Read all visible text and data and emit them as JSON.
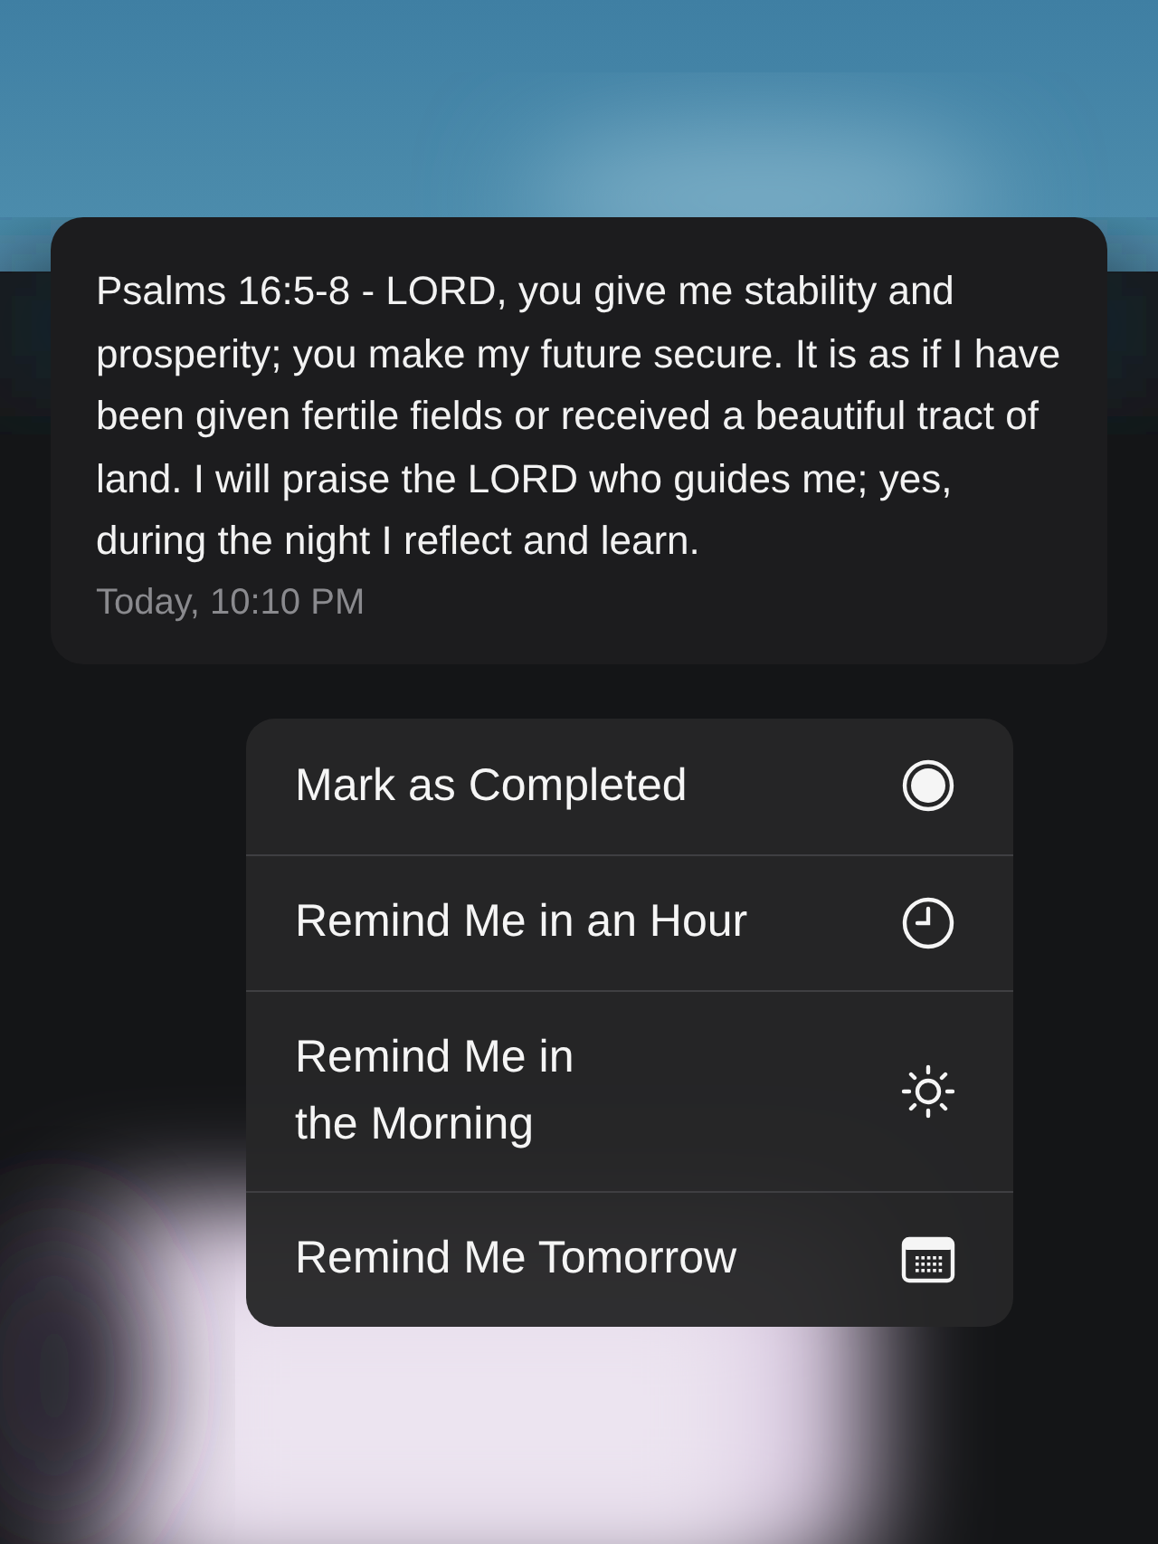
{
  "notification": {
    "message": "Psalms 16:5-8 - LORD, you give me stability and prosperity; you make my future secure. It is as if I have been given fertile fields or received a beautiful tract of land. I will praise the LORD who guides me; yes, during the night I reflect and learn.",
    "time": "Today, 10:10 PM"
  },
  "menu": [
    {
      "label": "Mark as Completed",
      "kind": "circle"
    },
    {
      "label": "Remind Me in an Hour",
      "kind": "clock"
    },
    {
      "label": "Remind Me in\nthe Morning",
      "kind": "sun"
    },
    {
      "label": "Remind Me Tomorrow",
      "kind": "calendar"
    }
  ]
}
